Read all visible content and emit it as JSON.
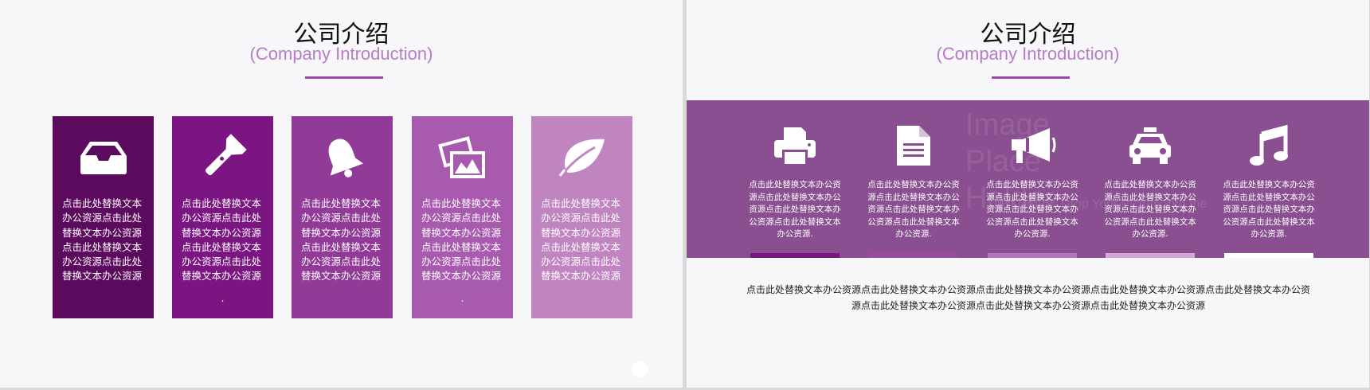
{
  "colors": {
    "card1": "#5c0a5e",
    "card2": "#7b1581",
    "card3": "#913a98",
    "card4": "#a85aaf",
    "card5": "#c084c1",
    "band": "#8a4f90",
    "subtitle": "#b77cc7",
    "title_line": "#9b4aa8"
  },
  "left_slide": {
    "title": "公司介绍",
    "subtitle": "(Company Introduction)",
    "cards": [
      {
        "icon": "inbox-tray-icon",
        "text": "点击此处替换文本办公资源点击此处替换文本办公资源点击此处替换文本办公资源点击此处替换文本办公资源",
        "dot": ""
      },
      {
        "icon": "flashlight-icon",
        "text": "点击此处替换文本办公资源点击此处替换文本办公资源点击此处替换文本办公资源点击此处替换文本办公资源",
        "dot": "."
      },
      {
        "icon": "bell-icon",
        "text": "点击此处替换文本办公资源点击此处替换文本办公资源点击此处替换文本办公资源点击此处替换文本办公资源",
        "dot": ""
      },
      {
        "icon": "pictures-icon",
        "text": "点击此处替换文本办公资源点击此处替换文本办公资源点击此处替换文本办公资源点击此处替换文本办公资源",
        "dot": "."
      },
      {
        "icon": "leaf-icon",
        "text": "点击此处替换文本办公资源点击此处替换文本办公资源点击此处替换文本办公资源点击此处替换文本办公资源",
        "dot": ""
      }
    ]
  },
  "right_slide": {
    "title": "公司介绍",
    "subtitle": "(Company Introduction)",
    "watermark": "Image Place Holder",
    "watermark_small": "Just Drag & Drop Your Picture Into me",
    "columns": [
      {
        "icon": "printer-icon",
        "text": "点击此处替换文本办公资源点击此处替换文本办公资源点击此处替换文本办公资源点击此处替换文本办公资源.",
        "bar_color": "#7b1581"
      },
      {
        "icon": "document-icon",
        "text": "点击此处替换文本办公资源点击此处替换文本办公资源点击此处替换文本办公资源点击此处替换文本办公资源.",
        "bar_color": "#9a4aa1"
      },
      {
        "icon": "megaphone-icon",
        "text": "点击此处替换文本办公资源点击此处替换文本办公资源点击此处替换文本办公资源点击此处替换文本办公资源.",
        "bar_color": "#b476bb"
      },
      {
        "icon": "taxi-icon",
        "text": "点击此处替换文本办公资源点击此处替换文本办公资源点击此处替换文本办公资源点击此处替换文本办公资源.",
        "bar_color": "#d2a9d5"
      },
      {
        "icon": "music-note-icon",
        "text": "点击此处替换文本办公资源点击此处替换文本办公资源点击此处替换文本办公资源点击此处替换文本办公资源.",
        "bar_color": "#ffffff"
      }
    ],
    "bottom_text": "点击此处替换文本办公资源点击此处替换文本办公资源点击此处替换文本办公资源点击此处替换文本办公资源点击此处替换文本办公资源点击此处替换文本办公资源点击此处替换文本办公资源点击此处替换文本办公资源"
  }
}
